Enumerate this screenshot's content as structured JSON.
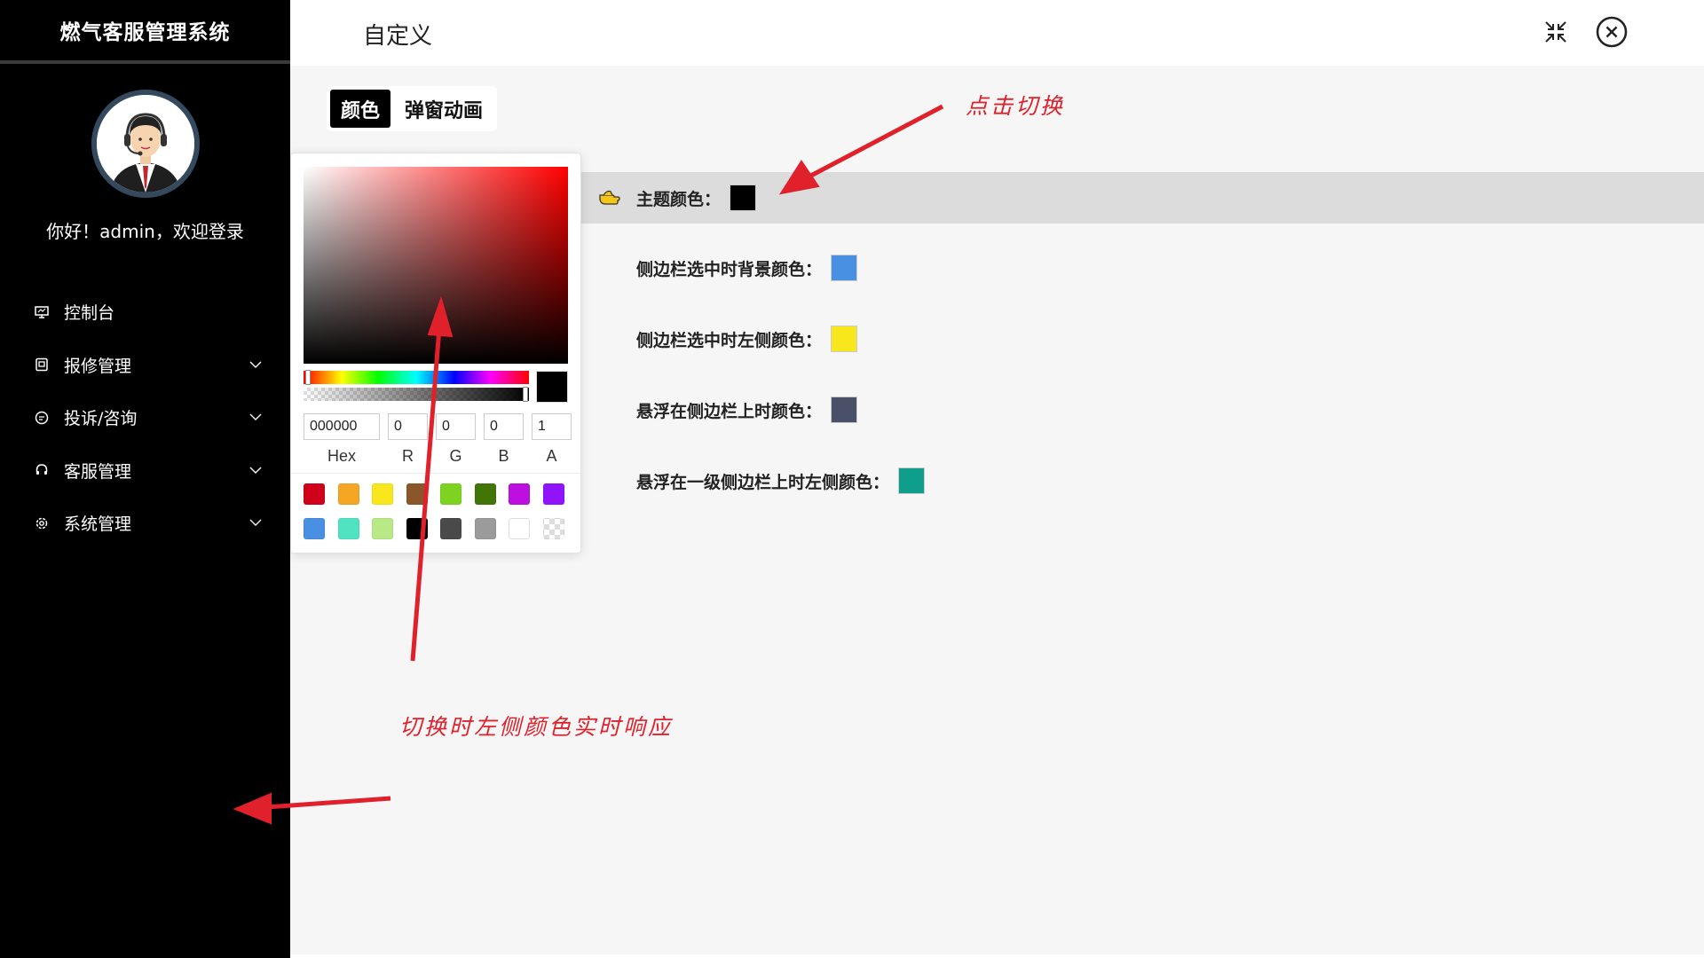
{
  "app": {
    "brand": "燃气客服管理系统"
  },
  "user": {
    "greeting": "你好！admin，欢迎登录"
  },
  "sidebar": {
    "items": [
      {
        "label": "控制台",
        "icon": "monitor-icon",
        "has_children": false
      },
      {
        "label": "报修管理",
        "icon": "repair-icon",
        "has_children": true
      },
      {
        "label": "投诉/咨询",
        "icon": "chat-icon",
        "has_children": true
      },
      {
        "label": "客服管理",
        "icon": "headset-icon",
        "has_children": true
      },
      {
        "label": "系统管理",
        "icon": "gear-icon",
        "has_children": true
      }
    ]
  },
  "header": {
    "title": "自定义",
    "collapse_icon": "shrink-icon",
    "close_icon": "close-circle-icon"
  },
  "tabs": [
    {
      "label": "颜色",
      "active": true
    },
    {
      "label": "弹窗动画",
      "active": false
    }
  ],
  "settings": {
    "theme": {
      "label": "主题颜色：",
      "color": "#000000"
    },
    "sidebar_active_bg": {
      "label": "侧边栏选中时背景颜色：",
      "color": "#4a90e2"
    },
    "sidebar_active_left": {
      "label": "侧边栏选中时左侧颜色：",
      "color": "#f8e71c"
    },
    "sidebar_hover": {
      "label": "悬浮在侧边栏上时颜色：",
      "color": "#4a5068"
    },
    "sidebar_hover_left": {
      "label": "悬浮在一级侧边栏上时左侧颜色：",
      "color": "#0f9d8c"
    }
  },
  "color_picker": {
    "hex": "000000",
    "r": "0",
    "g": "0",
    "b": "0",
    "a": "1",
    "labels": {
      "hex": "Hex",
      "r": "R",
      "g": "G",
      "b": "B",
      "a": "A"
    },
    "presets": [
      "#d0021b",
      "#f5a623",
      "#f8e71c",
      "#8b572a",
      "#7ed321",
      "#417505",
      "#bd10e0",
      "#9013fe",
      "#4a90e2",
      "#50e3c2",
      "#b8e986",
      "#000000",
      "#4a4a4a",
      "#9b9b9b",
      "#ffffff",
      "transparent"
    ]
  },
  "annotations": {
    "click_switch": "点击切换",
    "realtime": "切换时左侧颜色实时响应",
    "color": "#e0202a"
  }
}
